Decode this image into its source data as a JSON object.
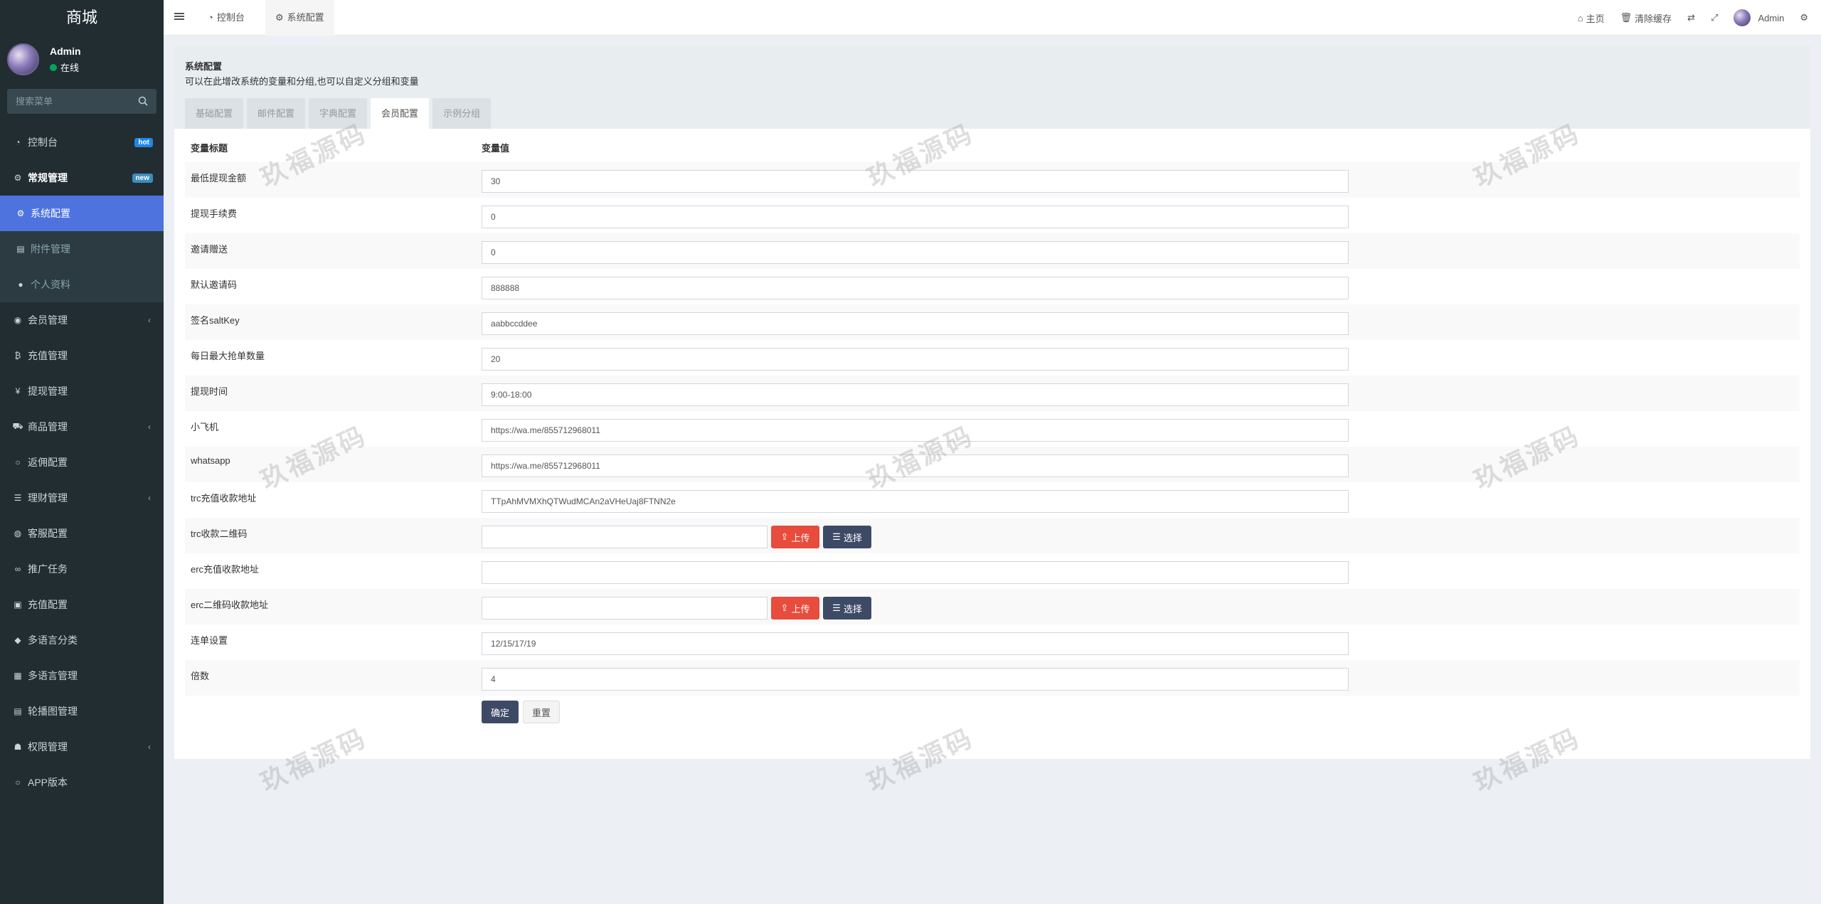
{
  "sidebar": {
    "logo": "商城",
    "user": {
      "name": "Admin",
      "status": "在线"
    },
    "search_placeholder": "搜索菜单",
    "items": [
      {
        "label": "控制台",
        "icon": "dashboard-icon",
        "badge": "hot"
      },
      {
        "label": "常规管理",
        "icon": "cogs-icon",
        "badge": "new"
      },
      {
        "label": "系统配置",
        "icon": "gear-icon"
      },
      {
        "label": "附件管理",
        "icon": "file-image-icon"
      },
      {
        "label": "个人资料",
        "icon": "user-icon"
      },
      {
        "label": "会员管理",
        "icon": "user-circle-icon"
      },
      {
        "label": "充值管理",
        "icon": "bitcoin-icon"
      },
      {
        "label": "提现管理",
        "icon": "yen-icon"
      },
      {
        "label": "商品管理",
        "icon": "cart-icon"
      },
      {
        "label": "返佣配置",
        "icon": "circle-icon"
      },
      {
        "label": "理财管理",
        "icon": "list-icon"
      },
      {
        "label": "客服配置",
        "icon": "chat-icon"
      },
      {
        "label": "推广任务",
        "icon": "link-icon"
      },
      {
        "label": "充值配置",
        "icon": "image-icon"
      },
      {
        "label": "多语言分类",
        "icon": "tag-icon"
      },
      {
        "label": "多语言管理",
        "icon": "language-icon"
      },
      {
        "label": "轮播图管理",
        "icon": "slides-icon"
      },
      {
        "label": "权限管理",
        "icon": "group-icon"
      },
      {
        "label": "APP版本",
        "icon": "circle-icon"
      }
    ]
  },
  "topbar": {
    "tabs": [
      {
        "label": "控制台"
      },
      {
        "label": "系统配置"
      }
    ],
    "right": {
      "home": "主页",
      "clear_cache": "清除缓存",
      "user": "Admin"
    }
  },
  "panel": {
    "title": "系统配置",
    "desc": "可以在此增改系统的变量和分组,也可以自定义分组和变量",
    "tabs": [
      "基础配置",
      "邮件配置",
      "字典配置",
      "会员配置",
      "示例分组"
    ],
    "active_tab": "会员配置"
  },
  "table": {
    "col_title": "变量标题",
    "col_value": "变量值",
    "rows": [
      {
        "label": "最低提现金额",
        "value": "30"
      },
      {
        "label": "提现手续费",
        "value": "0"
      },
      {
        "label": "邀请赠送",
        "value": "0"
      },
      {
        "label": "默认邀请码",
        "value": "888888"
      },
      {
        "label": "签名saltKey",
        "value": "aabbccddee"
      },
      {
        "label": "每日最大抢单数量",
        "value": "20"
      },
      {
        "label": "提现时间",
        "value": "9:00-18:00"
      },
      {
        "label": "小飞机",
        "value": "https://wa.me/855712968011"
      },
      {
        "label": "whatsapp",
        "value": "https://wa.me/855712968011"
      },
      {
        "label": "trc充值收款地址",
        "value": "TTpAhMVMXhQTWudMCAn2aVHeUaj8FTNN2e"
      },
      {
        "label": "trc收款二维码",
        "value": ""
      },
      {
        "label": "erc充值收款地址",
        "value": ""
      },
      {
        "label": "erc二维码收款地址",
        "value": ""
      },
      {
        "label": "连单设置",
        "value": "12/15/17/19"
      },
      {
        "label": "倍数",
        "value": "4"
      }
    ],
    "upload_label": "上传",
    "select_label": "选择",
    "ok_label": "确定",
    "reset_label": "重置"
  },
  "watermark": "玖福源码"
}
